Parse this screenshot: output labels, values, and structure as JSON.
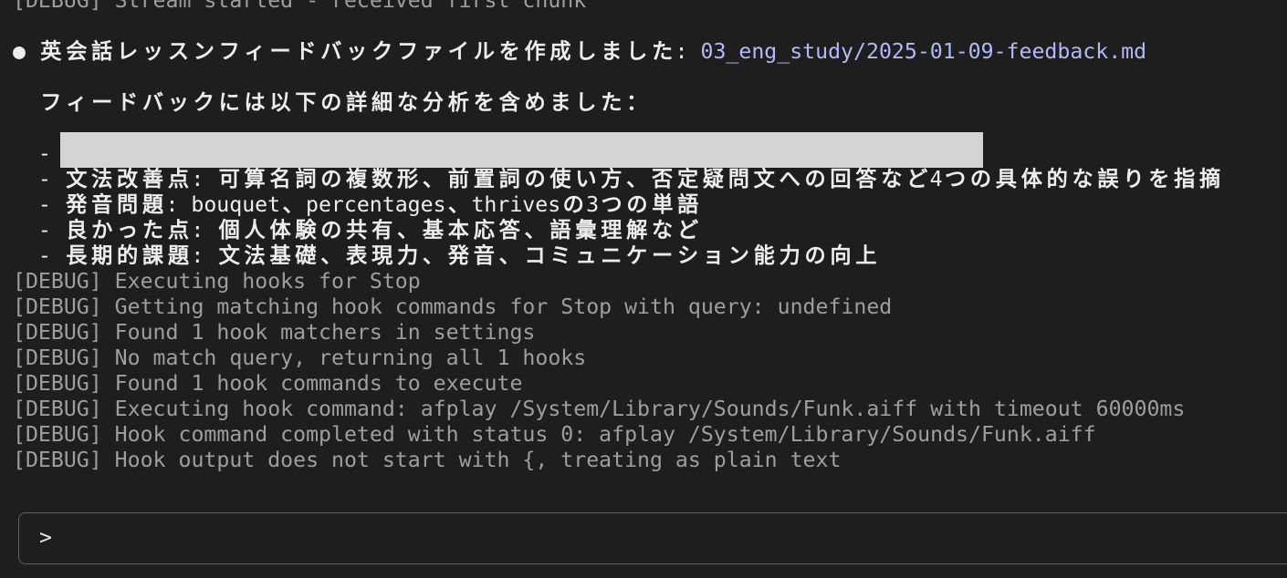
{
  "colors": {
    "background": "#1e1e1e",
    "text": "#ededed",
    "debug_text": "#9e9e9e",
    "file_path": "#b1b9f9",
    "redaction": "#d4d4d4",
    "input_border": "#5f5f5f",
    "prompt": "#e6e6e6"
  },
  "log": {
    "before": [
      "[DEBUG] Stream started - received first chunk"
    ],
    "after": [
      "[DEBUG] Executing hooks for Stop",
      "[DEBUG] Getting matching hook commands for Stop with query: undefined",
      "[DEBUG] Found 1 hook matchers in settings",
      "[DEBUG] No match query, returning all 1 hooks",
      "[DEBUG] Found 1 hook commands to execute",
      "[DEBUG] Executing hook command: afplay /System/Library/Sounds/Funk.aiff with timeout 60000ms",
      "[DEBUG] Hook command completed with status 0: afplay /System/Library/Sounds/Funk.aiff",
      "[DEBUG] Hook output does not start with {, treating as plain text"
    ]
  },
  "message": {
    "bullet": "●",
    "text": "英会話レッスンフィードバックファイルを作成しました:",
    "file_path": "03_eng_study/2025-01-09-feedback.md",
    "intro": "フィードバックには以下の詳細な分析を含めました：",
    "redacted_item": {
      "marker": "-"
    },
    "items": [
      {
        "marker": "-",
        "text": "文法改善点: 可算名詞の複数形、前置詞の使い方、否定疑問文への回答など4つの具体的な誤りを指摘"
      },
      {
        "marker": "-",
        "text": "発音問題: bouquet、percentages、thrivesの3つの単語"
      },
      {
        "marker": "-",
        "text": "良かった点: 個人体験の共有、基本応答、語彙理解など"
      },
      {
        "marker": "-",
        "text": "長期的課題: 文法基礎、表現力、発音、コミュニケーション能力の向上"
      }
    ]
  },
  "prompt": {
    "symbol": ">"
  }
}
